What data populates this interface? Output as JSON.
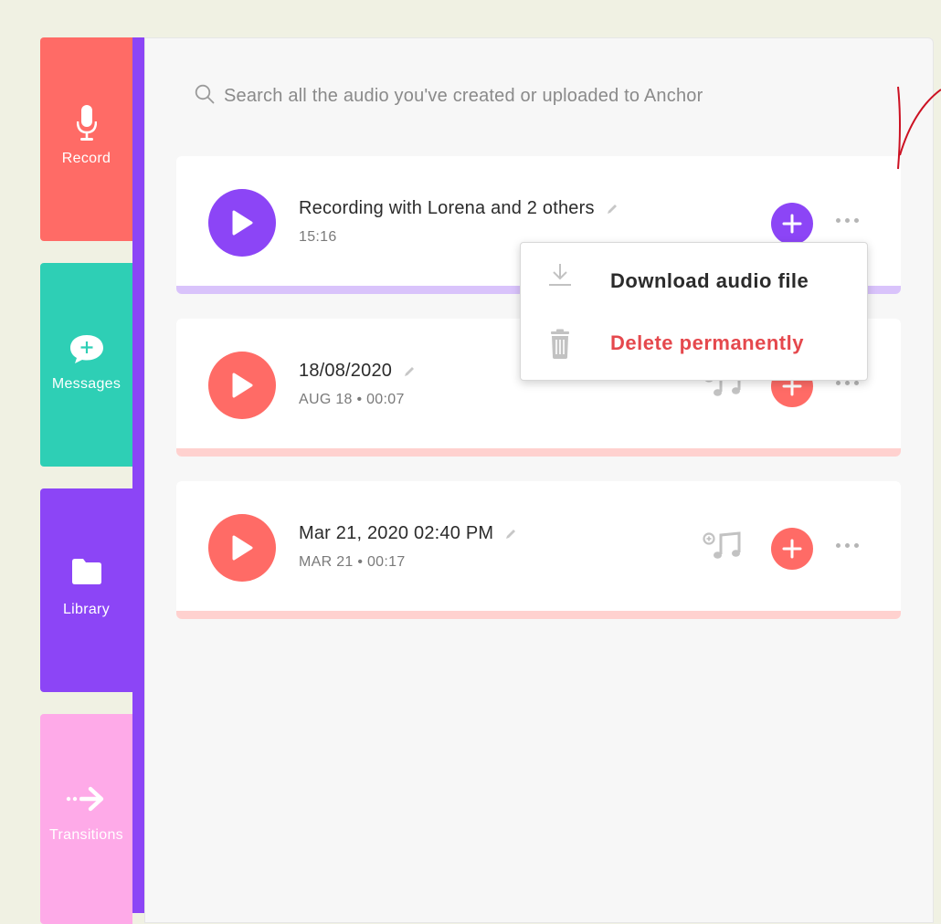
{
  "sidebar": {
    "items": [
      {
        "label": "Record",
        "icon": "microphone-icon",
        "color": "#ff6b66"
      },
      {
        "label": "Messages",
        "icon": "message-plus-icon",
        "color": "#2ecfb5"
      },
      {
        "label": "Library",
        "icon": "folder-icon",
        "color": "#8c45f6"
      },
      {
        "label": "Transitions",
        "icon": "arrow-right-icon",
        "color": "#feaae8"
      }
    ],
    "accent_color": "#8c45f6"
  },
  "search": {
    "placeholder": "Search all the audio you've created or uploaded to Anchor"
  },
  "recordings": [
    {
      "title": "Recording with Lorena and 2 others",
      "subtitle": "15:16",
      "accent": "#8c45f6",
      "bar": "#d9c3fb"
    },
    {
      "title": "18/08/2020",
      "subtitle": "AUG 18 • 00:07",
      "accent": "#ff6b66",
      "bar": "#ffd1cf"
    },
    {
      "title": "Mar 21, 2020 02:40 PM",
      "subtitle": "MAR 21 • 00:17",
      "accent": "#ff6b66",
      "bar": "#ffd1cf"
    }
  ],
  "menu": {
    "download_label": "Download audio file",
    "delete_label": "Delete permanently",
    "delete_color": "#e5484d"
  }
}
